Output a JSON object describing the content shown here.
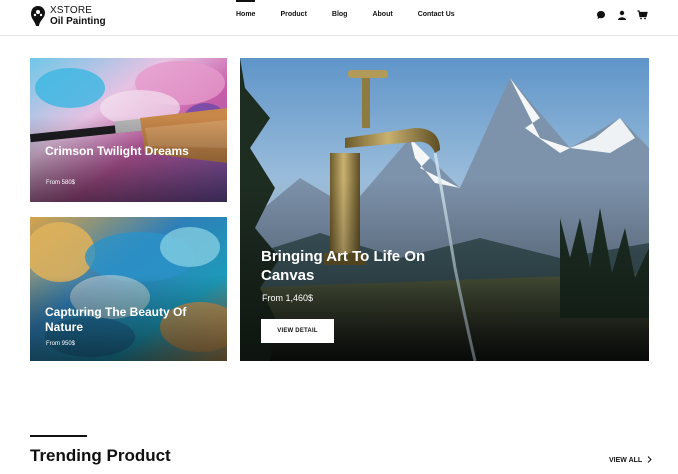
{
  "brand": {
    "line1": "XSTORE",
    "line2": "Oil Painting"
  },
  "nav": {
    "items": [
      {
        "label": "Home",
        "active": true
      },
      {
        "label": "Product",
        "active": false
      },
      {
        "label": "Blog",
        "active": false
      },
      {
        "label": "About",
        "active": false
      },
      {
        "label": "Contact Us",
        "active": false
      }
    ]
  },
  "header_icons": [
    "chat-icon",
    "user-icon",
    "cart-icon"
  ],
  "cards": [
    {
      "title": "Crimson Twilight Dreams",
      "price": "From 580$"
    },
    {
      "title": "Capturing The Beauty Of Nature",
      "price": "From 950$"
    },
    {
      "title": "Bringing Art To Life On Canvas",
      "price": "From 1,460$",
      "button": "VIEW DETAIL"
    }
  ],
  "trending": {
    "title": "Trending Product",
    "view_all": "VIEW ALL"
  },
  "colors": {
    "text": "#111111",
    "background": "#ffffff",
    "divider": "#e6e6e6"
  }
}
